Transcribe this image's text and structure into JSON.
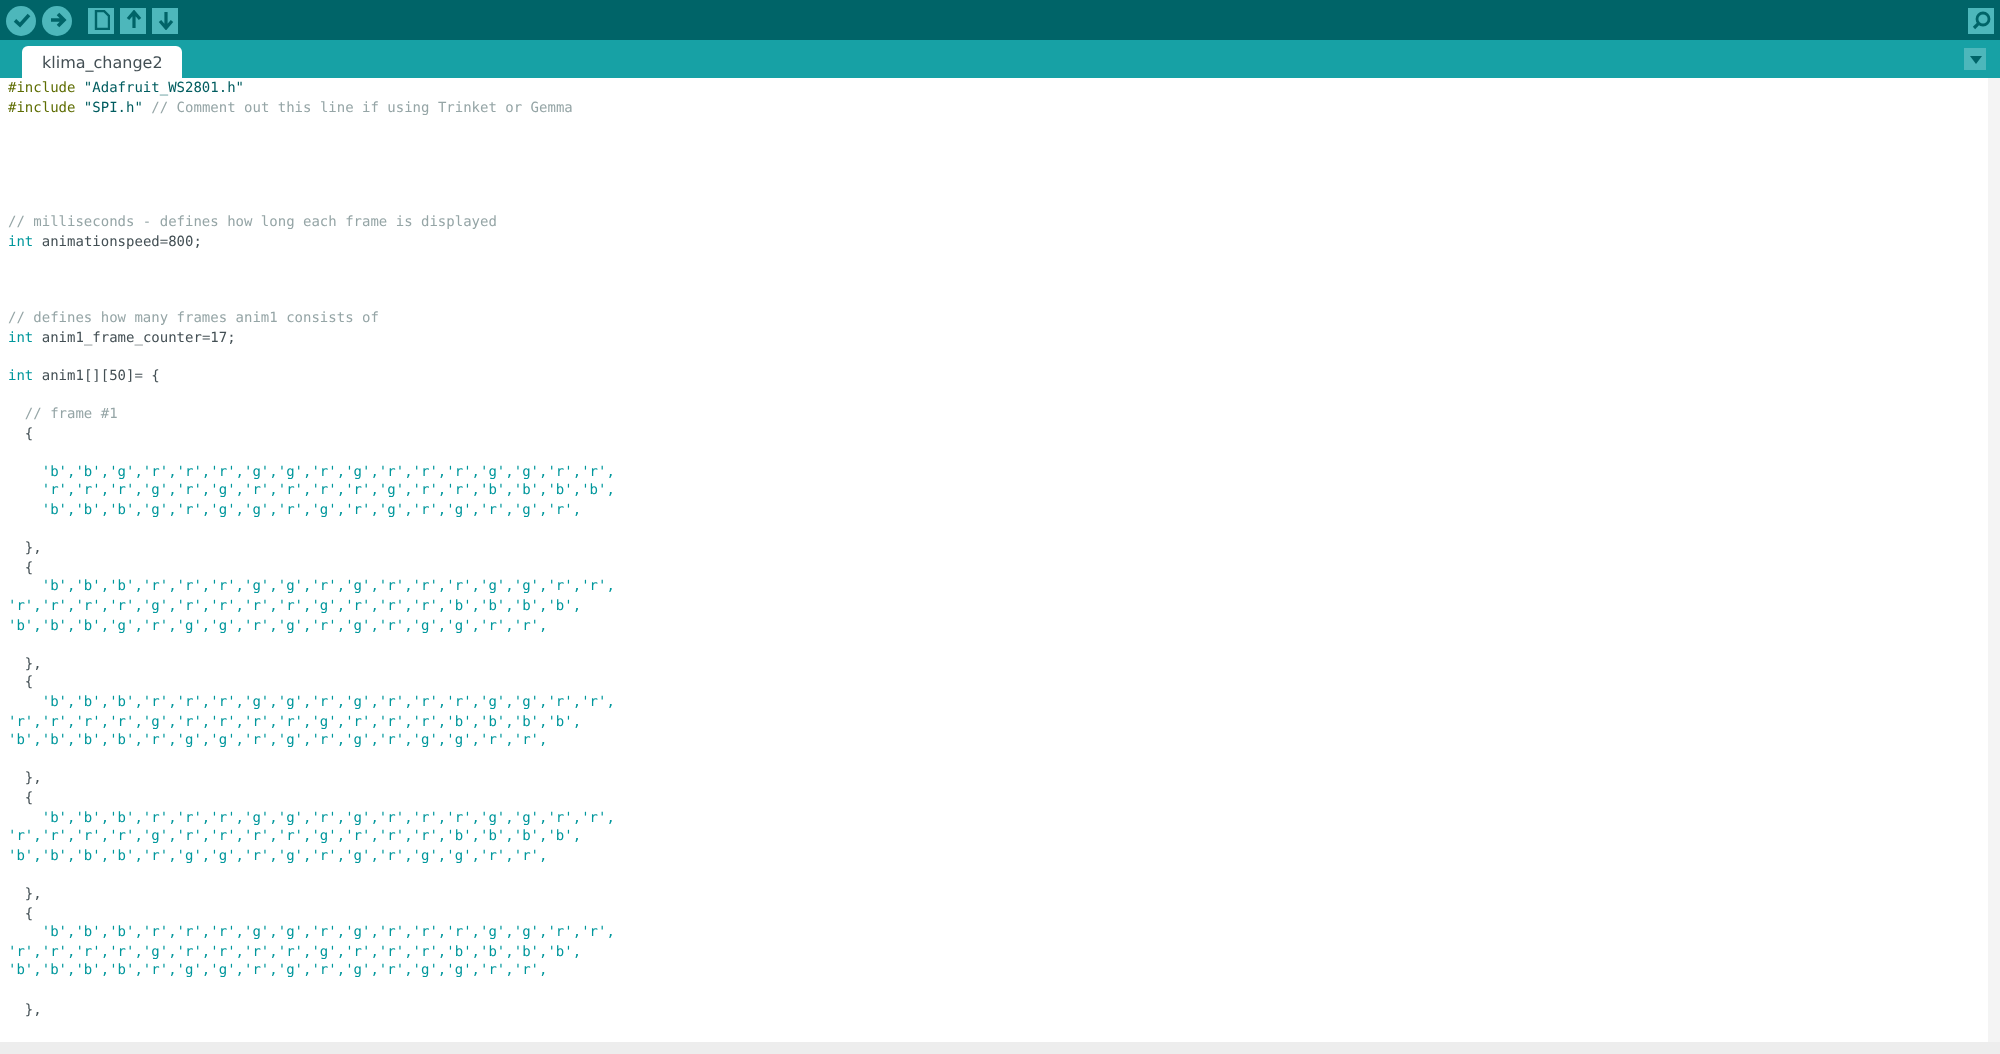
{
  "tabs": [
    {
      "label": "klima_change2",
      "selected": true
    }
  ],
  "code_lines": [
    {
      "kind": "code",
      "tokens": [
        {
          "kind": "preprocessor",
          "text": "#include"
        },
        {
          "kind": "string",
          "text": " \"Adafruit_WS2801.h\""
        }
      ]
    },
    {
      "kind": "code",
      "tokens": [
        {
          "kind": "preprocessor",
          "text": "#include"
        },
        {
          "kind": "string",
          "text": " \"SPI.h\""
        },
        {
          "kind": "comment",
          "text": " // Comment out this line if using Trinket or Gemma"
        }
      ]
    },
    {
      "kind": "blank"
    },
    {
      "kind": "blank"
    },
    {
      "kind": "blank"
    },
    {
      "kind": "blank"
    },
    {
      "kind": "blank"
    },
    {
      "kind": "code",
      "tokens": [
        {
          "kind": "comment",
          "text": "// milliseconds - defines how long each frame is displayed"
        }
      ]
    },
    {
      "kind": "code",
      "tokens": [
        {
          "kind": "keyword",
          "text": "int"
        },
        {
          "kind": "plain",
          "text": " animationspeed=800;"
        }
      ]
    },
    {
      "kind": "blank"
    },
    {
      "kind": "blank"
    },
    {
      "kind": "blank"
    },
    {
      "kind": "code",
      "tokens": [
        {
          "kind": "comment",
          "text": "// defines how many frames anim1 consists of"
        }
      ]
    },
    {
      "kind": "code",
      "tokens": [
        {
          "kind": "keyword",
          "text": "int"
        },
        {
          "kind": "plain",
          "text": " anim1_frame_counter=17;"
        }
      ]
    },
    {
      "kind": "blank"
    },
    {
      "kind": "code",
      "tokens": [
        {
          "kind": "keyword",
          "text": "int"
        },
        {
          "kind": "plain",
          "text": " anim1[][50]= {"
        }
      ]
    },
    {
      "kind": "blank"
    },
    {
      "kind": "code",
      "tokens": [
        {
          "kind": "comment",
          "text": "  // frame #1"
        }
      ]
    },
    {
      "kind": "code",
      "tokens": [
        {
          "kind": "plain",
          "text": "  {"
        }
      ]
    },
    {
      "kind": "blank"
    },
    {
      "kind": "code",
      "tokens": [
        {
          "kind": "literal",
          "text": "    'b','b','g','r','r','r','g','g','r','g','r','r','r','g','g','r','r',"
        }
      ]
    },
    {
      "kind": "code",
      "tokens": [
        {
          "kind": "literal",
          "text": "    'r','r','r','g','r','g','r','r','r','r','g','r','r','b','b','b','b',"
        }
      ]
    },
    {
      "kind": "code",
      "tokens": [
        {
          "kind": "literal",
          "text": "    'b','b','b','g','r','g','g','r','g','r','g','r','g','r','g','r',"
        }
      ]
    },
    {
      "kind": "blank"
    },
    {
      "kind": "code",
      "tokens": [
        {
          "kind": "plain",
          "text": "  },"
        }
      ]
    },
    {
      "kind": "code",
      "tokens": [
        {
          "kind": "plain",
          "text": "  {"
        }
      ]
    },
    {
      "kind": "code",
      "tokens": [
        {
          "kind": "literal",
          "text": "    'b','b','b','r','r','r','g','g','r','g','r','r','r','g','g','r','r',"
        }
      ]
    },
    {
      "kind": "code",
      "tokens": [
        {
          "kind": "literal",
          "text": "'r','r','r','r','g','r','r','r','r','g','r','r','r','b','b','b','b',"
        }
      ]
    },
    {
      "kind": "code",
      "tokens": [
        {
          "kind": "literal",
          "text": "'b','b','b','g','r','g','g','r','g','r','g','r','g','g','r','r',"
        }
      ]
    },
    {
      "kind": "blank"
    },
    {
      "kind": "code",
      "tokens": [
        {
          "kind": "plain",
          "text": "  },"
        }
      ]
    },
    {
      "kind": "code",
      "tokens": [
        {
          "kind": "plain",
          "text": "  {"
        }
      ]
    },
    {
      "kind": "code",
      "tokens": [
        {
          "kind": "literal",
          "text": "    'b','b','b','r','r','r','g','g','r','g','r','r','r','g','g','r','r',"
        }
      ]
    },
    {
      "kind": "code",
      "tokens": [
        {
          "kind": "literal",
          "text": "'r','r','r','r','g','r','r','r','r','g','r','r','r','b','b','b','b',"
        }
      ]
    },
    {
      "kind": "code",
      "tokens": [
        {
          "kind": "literal",
          "text": "'b','b','b','b','r','g','g','r','g','r','g','r','g','g','r','r',"
        }
      ]
    },
    {
      "kind": "blank"
    },
    {
      "kind": "code",
      "tokens": [
        {
          "kind": "plain",
          "text": "  },"
        }
      ]
    },
    {
      "kind": "code",
      "tokens": [
        {
          "kind": "plain",
          "text": "  {"
        }
      ]
    },
    {
      "kind": "code",
      "tokens": [
        {
          "kind": "literal",
          "text": "    'b','b','b','r','r','r','g','g','r','g','r','r','r','g','g','r','r',"
        }
      ]
    },
    {
      "kind": "code",
      "tokens": [
        {
          "kind": "literal",
          "text": "'r','r','r','r','g','r','r','r','r','g','r','r','r','b','b','b','b',"
        }
      ]
    },
    {
      "kind": "code",
      "tokens": [
        {
          "kind": "literal",
          "text": "'b','b','b','b','r','g','g','r','g','r','g','r','g','g','r','r',"
        }
      ]
    },
    {
      "kind": "blank"
    },
    {
      "kind": "code",
      "tokens": [
        {
          "kind": "plain",
          "text": "  },"
        }
      ]
    },
    {
      "kind": "code",
      "tokens": [
        {
          "kind": "plain",
          "text": "  {"
        }
      ]
    },
    {
      "kind": "code",
      "tokens": [
        {
          "kind": "literal",
          "text": "    'b','b','b','r','r','r','g','g','r','g','r','r','r','g','g','r','r',"
        }
      ]
    },
    {
      "kind": "code",
      "tokens": [
        {
          "kind": "literal",
          "text": "'r','r','r','r','g','r','r','r','r','g','r','r','r','b','b','b','b',"
        }
      ]
    },
    {
      "kind": "code",
      "tokens": [
        {
          "kind": "literal",
          "text": "'b','b','b','b','r','g','g','r','g','r','g','r','g','g','r','r',"
        }
      ]
    },
    {
      "kind": "blank"
    },
    {
      "kind": "code",
      "tokens": [
        {
          "kind": "plain",
          "text": "  },"
        }
      ]
    }
  ]
}
